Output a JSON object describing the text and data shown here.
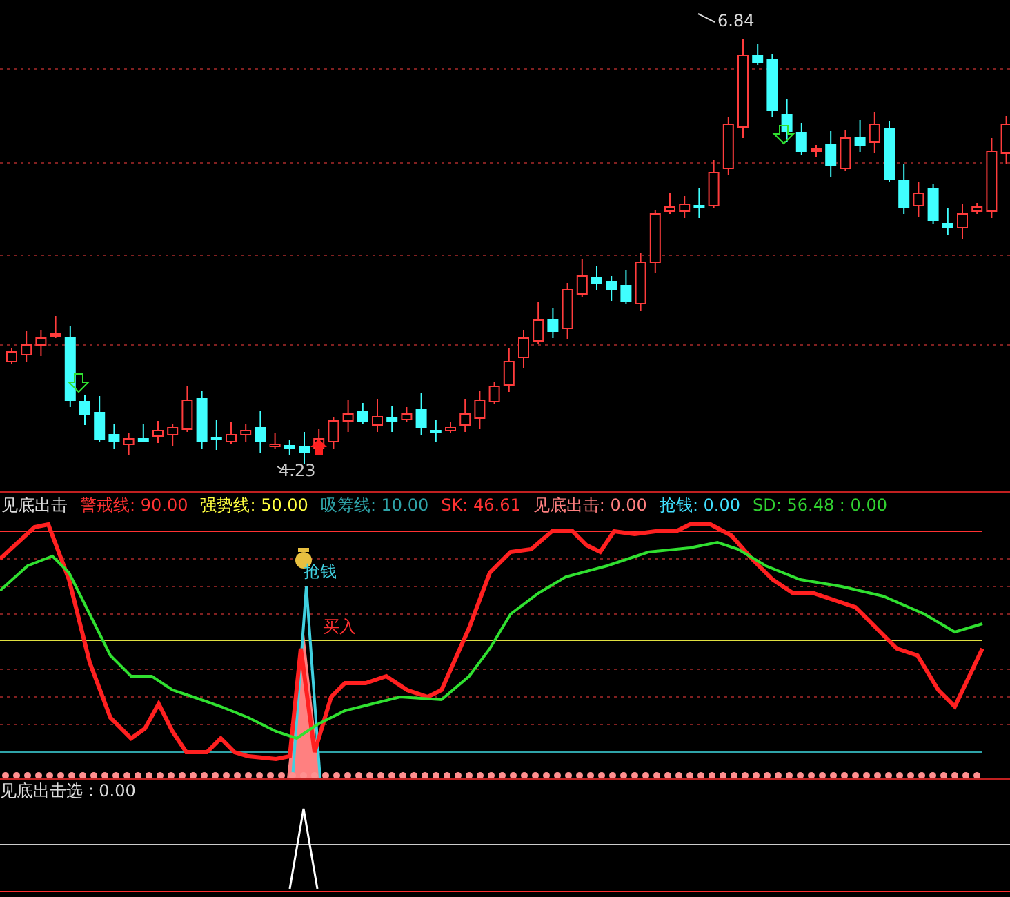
{
  "price_panel": {
    "high_label": "6.84",
    "low_label": "4.23"
  },
  "indicator_panel": {
    "title": "见底出击",
    "legend": [
      {
        "label": "警戒线: 90.00",
        "color": "#ff3232"
      },
      {
        "label": "强势线: 50.00",
        "color": "#ffff40"
      },
      {
        "label": "吸筹线: 10.00",
        "color": "#2fa3a8"
      },
      {
        "label": "SK: 46.61",
        "color": "#ff3232"
      },
      {
        "label": "见底出击: 0.00",
        "color": "#ff8080"
      },
      {
        "label": "抢钱: 0.00",
        "color": "#40e0ff"
      },
      {
        "label": "SD: 56.48 : 0.00",
        "color": "#30d030"
      }
    ],
    "signals": [
      {
        "text": "抢钱",
        "kind": "sell"
      },
      {
        "text": "买入",
        "kind": "buy"
      }
    ]
  },
  "bottom_panel": {
    "title": "见底出击选 : 0.00"
  }
}
